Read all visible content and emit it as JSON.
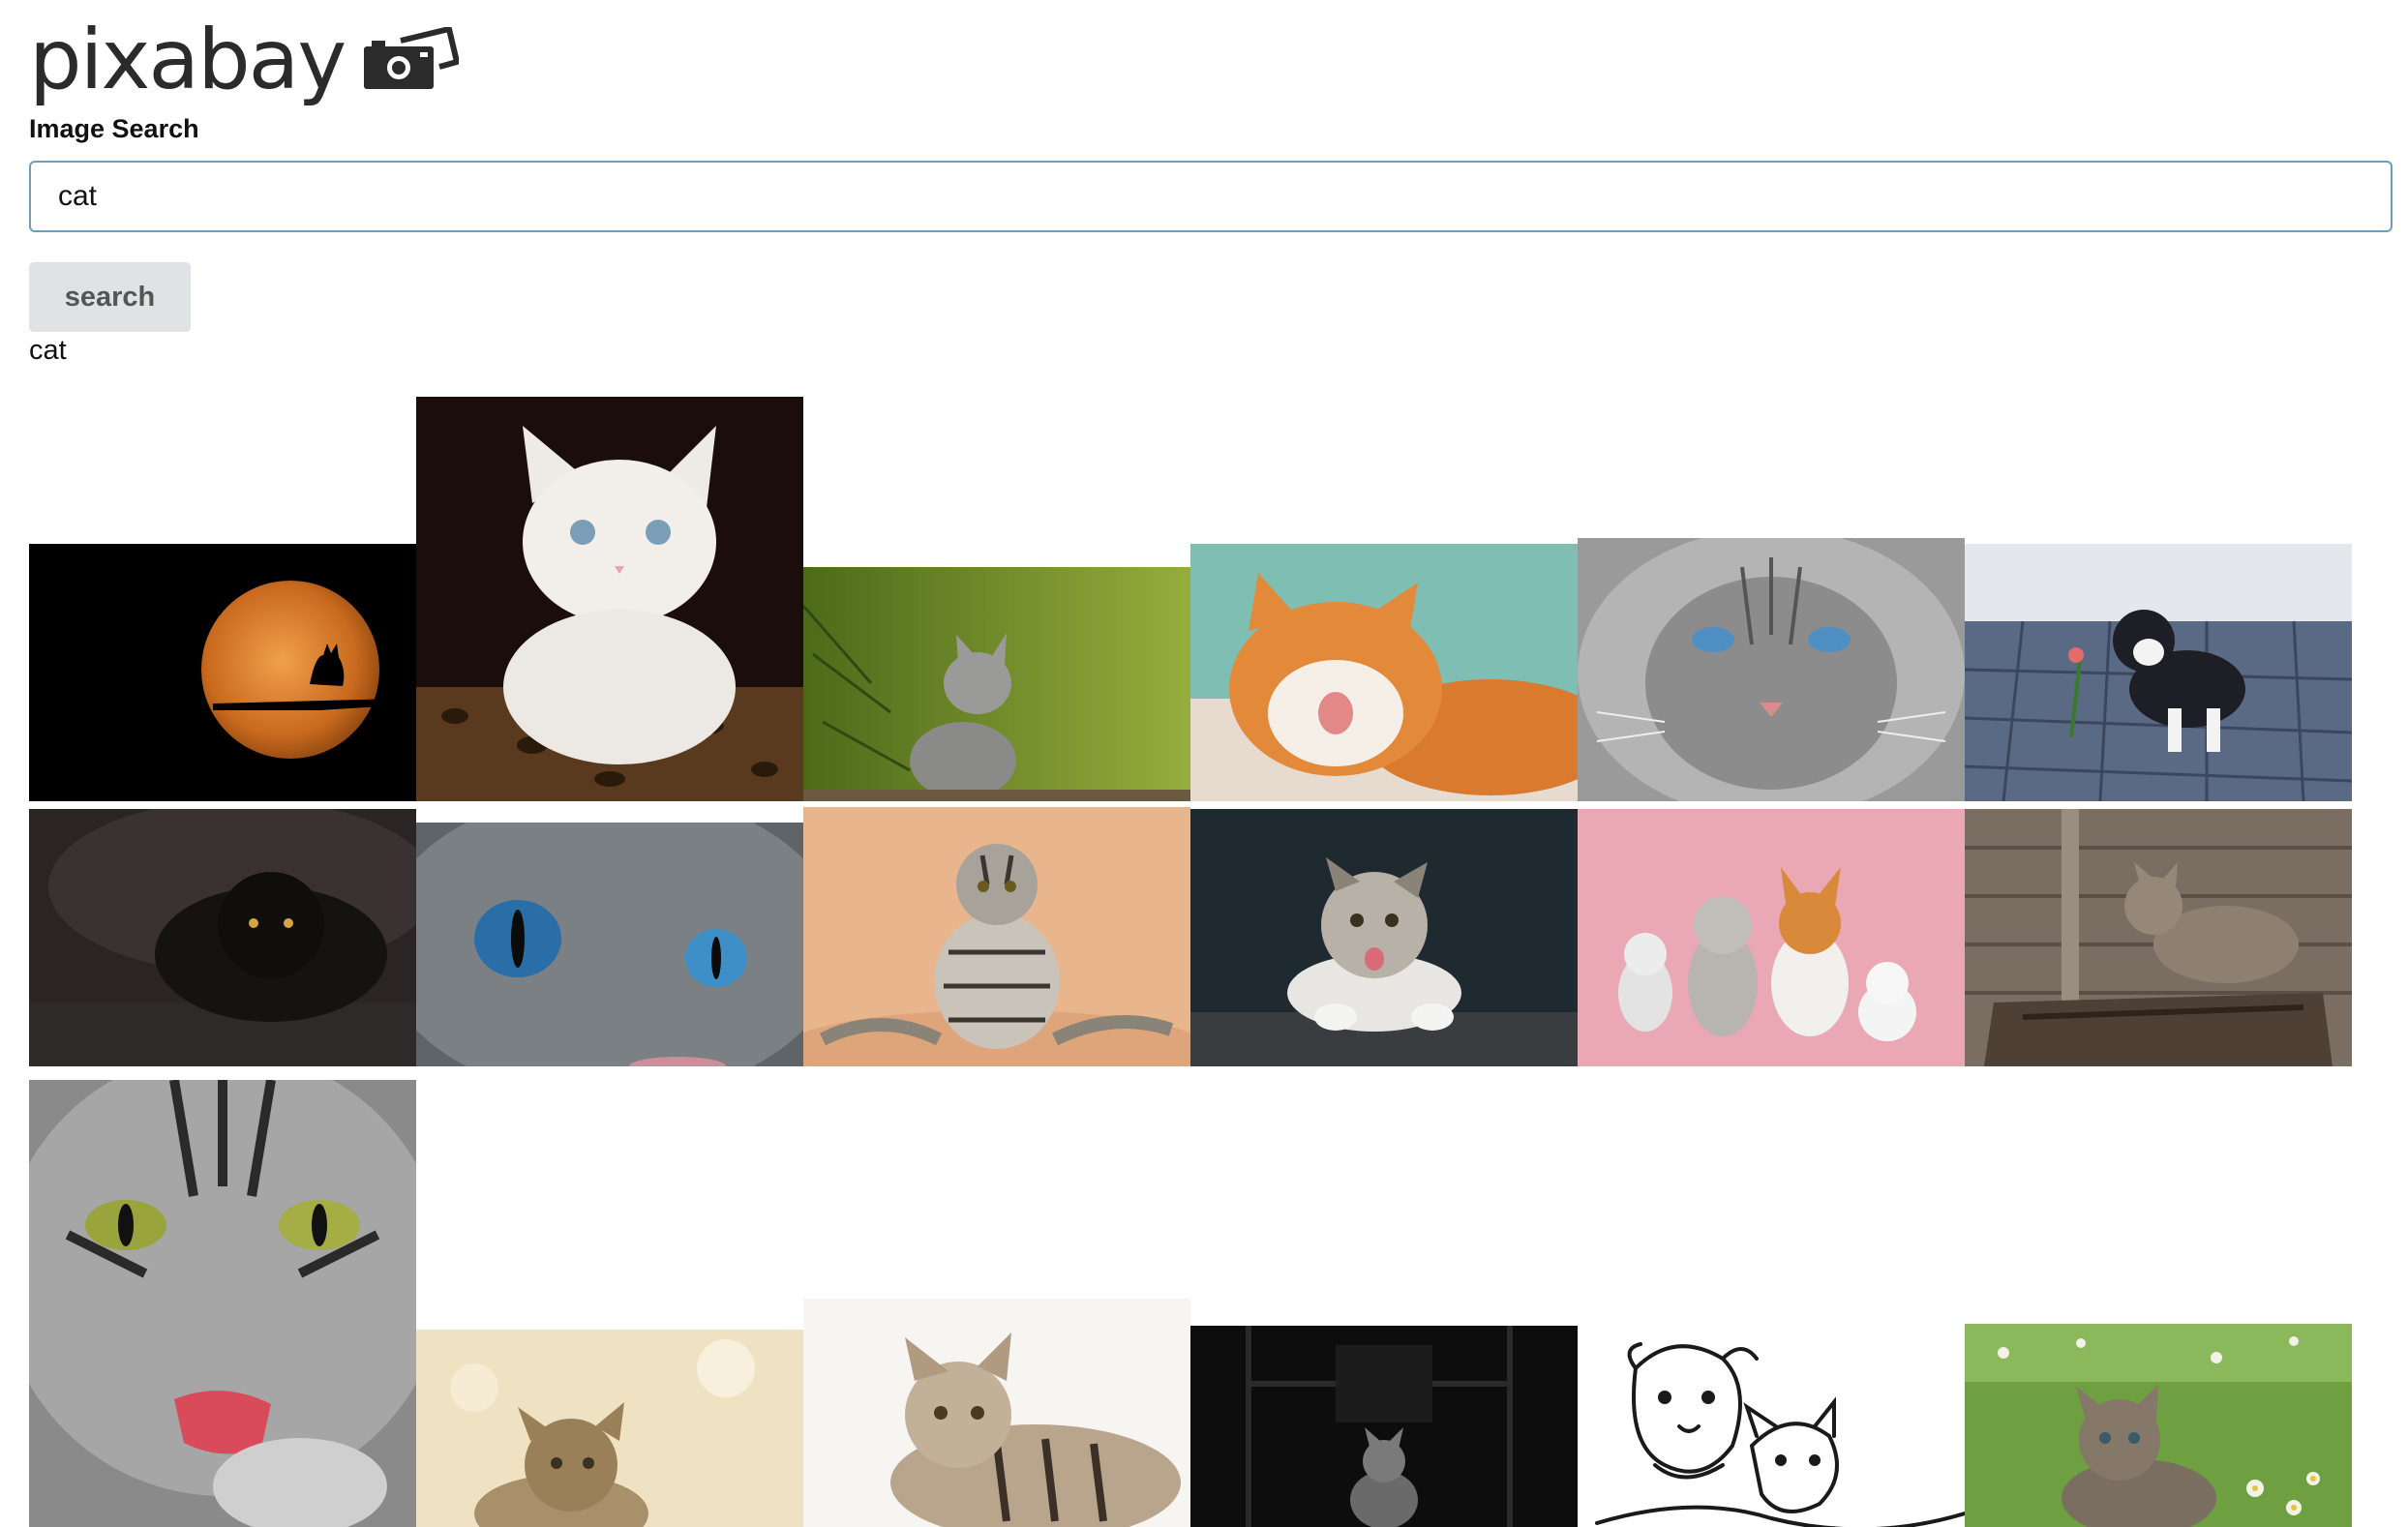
{
  "header": {
    "logo_text": "pixabay"
  },
  "search": {
    "label": "Image Search",
    "value": "cat",
    "button_label": "search",
    "result_query": "cat"
  },
  "results": [
    {
      "name": "cat-silhouette-moon"
    },
    {
      "name": "white-kitten"
    },
    {
      "name": "kitten-in-grass"
    },
    {
      "name": "orange-cat-licking"
    },
    {
      "name": "grey-cat-blue-eyes"
    },
    {
      "name": "kitten-playing-cobblestones"
    },
    {
      "name": "black-cat-dark"
    },
    {
      "name": "cat-eyes-closeup"
    },
    {
      "name": "scottish-fold-sitting"
    },
    {
      "name": "kitten-tongue-out"
    },
    {
      "name": "cats-and-dogs-pink"
    },
    {
      "name": "tabby-cat-wooden-box"
    },
    {
      "name": "tabby-cat-licking-paw"
    },
    {
      "name": "kitten-looking-up"
    },
    {
      "name": "tabby-kitten-lying"
    },
    {
      "name": "kitten-dark-room"
    },
    {
      "name": "dog-and-cat-drawing"
    },
    {
      "name": "kitten-in-flowers"
    }
  ]
}
